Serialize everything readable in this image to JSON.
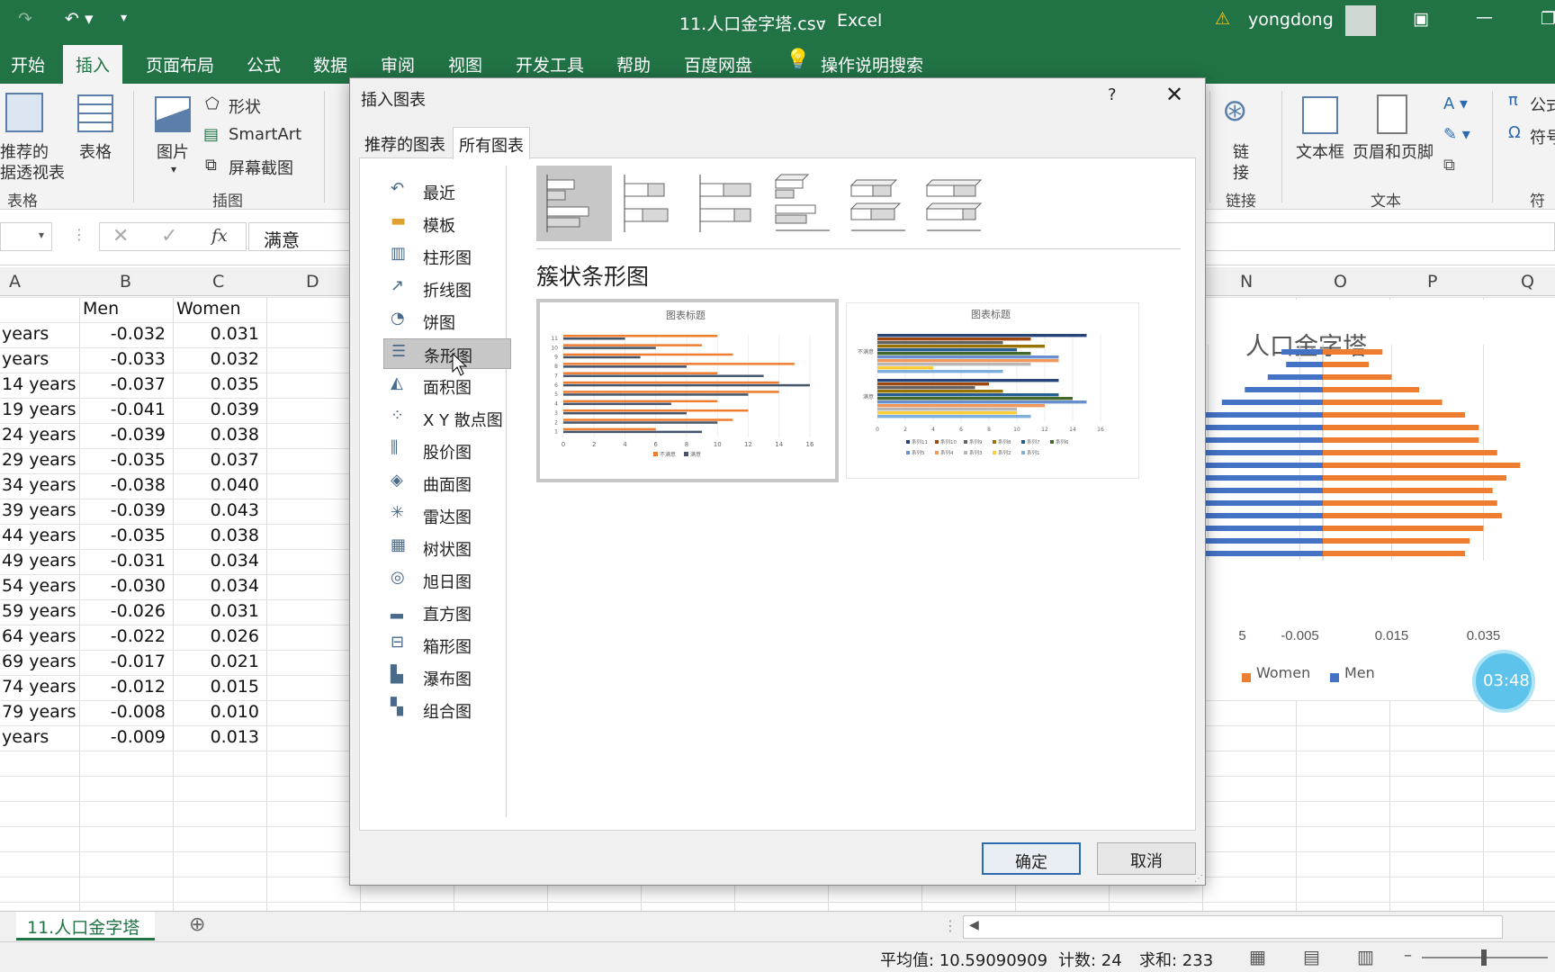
{
  "titlebar": {
    "filename": "11.人口金字塔.csv",
    "separator": "-",
    "app": "Excel",
    "user": "yongdong"
  },
  "ribbon_tabs": [
    "开始",
    "插入",
    "页面布局",
    "公式",
    "数据",
    "审阅",
    "视图",
    "开发工具",
    "帮助",
    "百度网盘",
    "操作说明搜索"
  ],
  "ribbon": {
    "pivot_line1": "推荐的",
    "pivot_line2": "据透视表",
    "table": "表格",
    "group_table": "表格",
    "picture": "图片",
    "shapes": "形状",
    "smartart": "SmartArt",
    "screenshot": "屏幕截图",
    "group_illustrations": "插图",
    "link_line1": "链",
    "link_line2": "接",
    "group_link": "链接",
    "textbox": "文本框",
    "header_footer": "页眉和页脚",
    "group_text": "文本",
    "formula": "公式",
    "symbol": "符号",
    "group_symbol": "符号"
  },
  "formula_bar": {
    "fx": "fx",
    "value": "满意"
  },
  "columns": [
    "A",
    "B",
    "C",
    "D",
    "N",
    "O",
    "P",
    "Q"
  ],
  "grid": {
    "header_row": [
      "",
      "Men",
      "Women"
    ],
    "rows": [
      [
        "years",
        "-0.032",
        "0.031"
      ],
      [
        "years",
        "-0.033",
        "0.032"
      ],
      [
        "14 years",
        "-0.037",
        "0.035"
      ],
      [
        "19 years",
        "-0.041",
        "0.039"
      ],
      [
        "24 years",
        "-0.039",
        "0.038"
      ],
      [
        "29 years",
        "-0.035",
        "0.037"
      ],
      [
        "34 years",
        "-0.038",
        "0.040"
      ],
      [
        "39 years",
        "-0.039",
        "0.043"
      ],
      [
        "44 years",
        "-0.035",
        "0.038"
      ],
      [
        "49 years",
        "-0.031",
        "0.034"
      ],
      [
        "54 years",
        "-0.030",
        "0.034"
      ],
      [
        "59 years",
        "-0.026",
        "0.031"
      ],
      [
        "64 years",
        "-0.022",
        "0.026"
      ],
      [
        "69 years",
        "-0.017",
        "0.021"
      ],
      [
        "74 years",
        "-0.012",
        "0.015"
      ],
      [
        "79 years",
        "-0.008",
        "0.010"
      ],
      [
        "years",
        "-0.009",
        "0.013"
      ]
    ]
  },
  "dialog": {
    "title": "插入图表",
    "help": "?",
    "tabs": [
      "推荐的图表",
      "所有图表"
    ],
    "nav": [
      "最近",
      "模板",
      "柱形图",
      "折线图",
      "饼图",
      "条形图",
      "面积图",
      "X Y 散点图",
      "股价图",
      "曲面图",
      "雷达图",
      "树状图",
      "旭日图",
      "直方图",
      "箱形图",
      "瀑布图",
      "组合图"
    ],
    "selected_nav": "条形图",
    "subtype_name": "簇状条形图",
    "ok": "确定",
    "cancel": "取消",
    "preview1": {
      "title": "图表标题",
      "y_ticks": [
        "11",
        "10",
        "9",
        "8",
        "7",
        "6",
        "5",
        "4",
        "3",
        "2",
        "1"
      ],
      "x_ticks": [
        "0",
        "2",
        "4",
        "6",
        "8",
        "10",
        "12",
        "14",
        "16"
      ],
      "legend": [
        "不满意",
        "满意"
      ]
    },
    "preview2": {
      "title": "图表标题",
      "categories": [
        "不满意",
        "满意"
      ],
      "x_ticks": [
        "0",
        "2",
        "4",
        "6",
        "8",
        "10",
        "12",
        "14",
        "16"
      ],
      "legend_row1": [
        "系列11",
        "系列10",
        "系列9",
        "系列8",
        "系列7",
        "系列6"
      ],
      "legend_row2": [
        "系列5",
        "系列4",
        "系列3",
        "系列2",
        "系列1"
      ]
    }
  },
  "chart": {
    "title": "人口金字塔",
    "x_ticks": [
      "5",
      "-0.005",
      "0.015",
      "0.035"
    ],
    "legend": [
      "Women",
      "Men"
    ],
    "color_women": "#ed7d31",
    "color_men": "#4472c4",
    "women": [
      0.013,
      0.01,
      0.015,
      0.021,
      0.026,
      0.031,
      0.034,
      0.034,
      0.038,
      0.043,
      0.04,
      0.037,
      0.038,
      0.039,
      0.035,
      0.032,
      0.031
    ],
    "men": [
      -0.009,
      -0.008,
      -0.012,
      -0.017,
      -0.022,
      -0.026,
      -0.03,
      -0.031,
      -0.035,
      -0.039,
      -0.038,
      -0.035,
      -0.039,
      -0.041,
      -0.037,
      -0.033,
      -0.032
    ]
  },
  "timer": "03:48",
  "sheet_tab": "11.人口金字塔",
  "status": {
    "avg": "平均值: 10.59090909",
    "count": "计数: 24",
    "sum": "求和: 233"
  }
}
